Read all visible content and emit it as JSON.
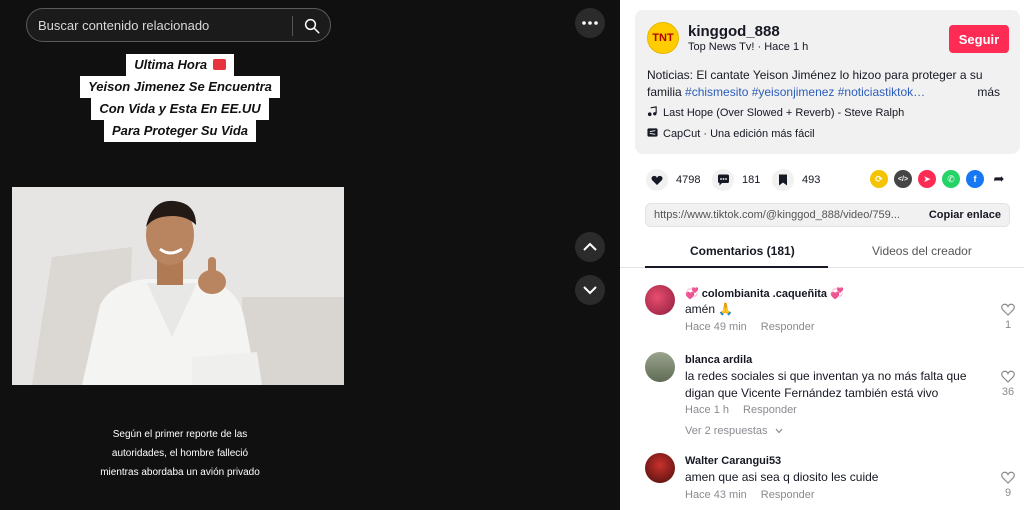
{
  "search": {
    "placeholder": "Buscar contenido relacionado"
  },
  "video": {
    "headline_lines": [
      "Ultima Hora",
      "Yeison Jimenez Se Encuentra",
      "Con Vida y Esta En EE.UU",
      "Para Proteger Su Vida"
    ],
    "caption_lines": [
      "Según el primer reporte de las",
      "autoridades, el hombre falleció",
      "mientras abordaba un avión privado"
    ]
  },
  "author": {
    "avatar_text": "TNT",
    "username": "kinggod_888",
    "subtitle": "Top News Tv! · Hace 1 h",
    "follow_label": "Seguir",
    "description": "Noticias: El cantate Yeison Jiménez lo hizoo para proteger a su familia ",
    "hashtags": "#chismesito #yeisonjimenez #noticiastiktok…",
    "more_label": "más",
    "music": "Last Hope (Over Slowed + Reverb) - Steve Ralph",
    "capcut": "CapCut · Una edición más fácil"
  },
  "stats": {
    "likes": "4798",
    "comments": "181",
    "saves": "493"
  },
  "share_icons": [
    {
      "name": "repost-icon",
      "color": "#f5c400",
      "glyph": "⟳"
    },
    {
      "name": "embed-icon",
      "color": "#454545",
      "glyph": "</>"
    },
    {
      "name": "send-icon",
      "color": "#fe2c55",
      "glyph": "➤"
    },
    {
      "name": "whatsapp-icon",
      "color": "#25d366",
      "glyph": "✆"
    },
    {
      "name": "facebook-icon",
      "color": "#1877f2",
      "glyph": "f"
    }
  ],
  "link": {
    "url": "https://www.tiktok.com/@kinggod_888/video/759...",
    "copy_label": "Copiar enlace"
  },
  "tabs": {
    "comments": "Comentarios (181)",
    "creator": "Videos del creador"
  },
  "comments": [
    {
      "name": "💞 colombianita .caqueñita 💞",
      "text": "amén 🙏",
      "time": "Hace 49 min",
      "reply": "Responder",
      "likes": "1"
    },
    {
      "name": "blanca ardila",
      "text": "la redes sociales si que inventan ya no más falta que digan que Vicente Fernández también está vivo",
      "time": "Hace 1 h",
      "reply": "Responder",
      "likes": "36",
      "view_replies": "Ver 2 respuestas"
    },
    {
      "name": "Walter Carangui53",
      "text": "amen que asi sea q diosito les cuide",
      "time": "Hace 43 min",
      "reply": "Responder",
      "likes": "9"
    }
  ]
}
